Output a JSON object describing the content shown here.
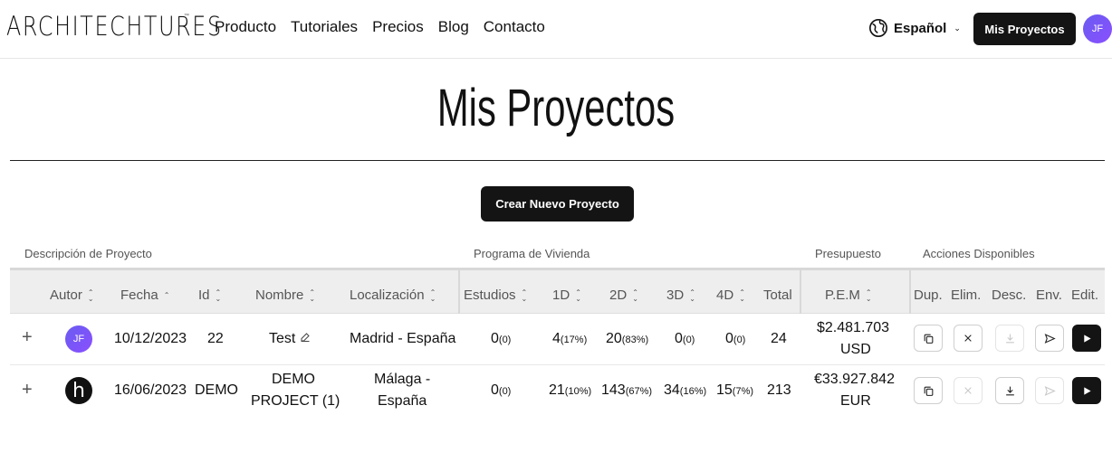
{
  "header": {
    "logo_text": "ARCHITECHTURES",
    "logo_tm": "™",
    "nav": [
      "Producto",
      "Tutoriales",
      "Precios",
      "Blog",
      "Contacto"
    ],
    "language": "Español",
    "mis_proyectos_button": "Mis Proyectos",
    "user_initials": "JF"
  },
  "page": {
    "title": "Mis Proyectos",
    "create_button": "Crear Nuevo Proyecto"
  },
  "table": {
    "groups": {
      "description": "Descripción de Proyecto",
      "program": "Programa de Vivienda",
      "budget": "Presupuesto",
      "actions": "Acciones Disponibles"
    },
    "columns": {
      "autor": "Autor",
      "fecha": "Fecha",
      "id": "Id",
      "nombre": "Nombre",
      "localizacion": "Localización",
      "estudios": "Estudios",
      "d1": "1D",
      "d2": "2D",
      "d3": "3D",
      "d4": "4D",
      "total": "Total",
      "pem": "P.E.M",
      "dup": "Dup.",
      "elim": "Elim.",
      "desc": "Desc.",
      "env": "Env.",
      "edit": "Edit."
    },
    "rows": [
      {
        "expand": "+",
        "autor_initials": "JF",
        "fecha": "10/12/2023",
        "id": "22",
        "nombre": "Test",
        "localizacion": "Madrid - España",
        "estudios": "0",
        "estudios_pct": "(0)",
        "d1": "4",
        "d1_pct": "(17%)",
        "d2": "20",
        "d2_pct": "(83%)",
        "d3": "0",
        "d3_pct": "(0)",
        "d4": "0",
        "d4_pct": "(0)",
        "total": "24",
        "pem": "$2.481.703",
        "currency": "USD"
      },
      {
        "expand": "+",
        "autor_logo": "h",
        "fecha": "16/06/2023",
        "id": "DEMO",
        "nombre_l1": "DEMO",
        "nombre_l2": "PROJECT (1)",
        "localizacion_l1": "Málaga -",
        "localizacion_l2": "España",
        "estudios": "0",
        "estudios_pct": "(0)",
        "d1": "21",
        "d1_pct": "(10%)",
        "d2": "143",
        "d2_pct": "(67%)",
        "d3": "34",
        "d3_pct": "(16%)",
        "d4": "15",
        "d4_pct": "(7%)",
        "total": "213",
        "pem": "€33.927.842",
        "currency": "EUR"
      }
    ]
  },
  "colors": {
    "dark_button": "#141414",
    "avatar_gradient": "#6a5cf0",
    "header_bg": "#eeeeee"
  },
  "icons": [
    "globe-icon",
    "chevron-down-icon",
    "sort-icon",
    "edit-icon",
    "duplicate-icon",
    "close-icon",
    "download-icon",
    "send-icon",
    "play-icon",
    "plus-icon"
  ]
}
